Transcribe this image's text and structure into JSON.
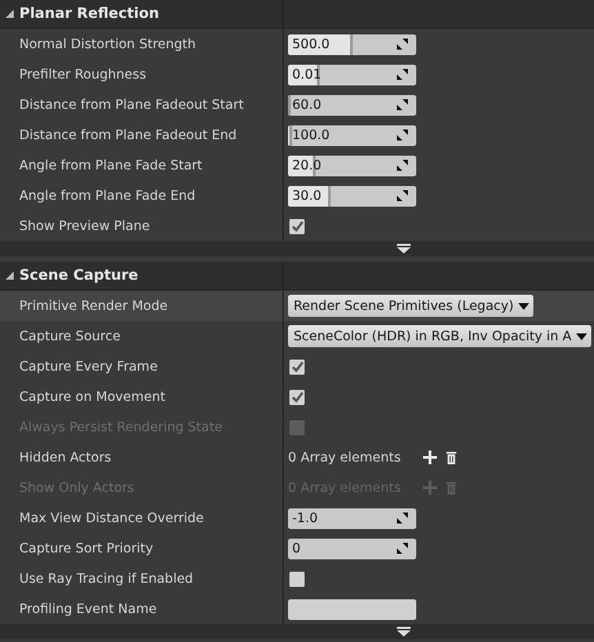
{
  "sections": [
    {
      "title": "Planar Reflection",
      "expanded": true,
      "rows": [
        {
          "label": "Normal Distortion Strength",
          "kind": "spin",
          "value": "500.0",
          "level": 0.5,
          "highlighted": false,
          "disabled": false
        },
        {
          "label": "Prefilter Roughness",
          "kind": "spin",
          "value": "0.01",
          "level": 0.25,
          "highlighted": false,
          "disabled": false
        },
        {
          "label": "Distance from Plane Fadeout Start",
          "kind": "spin",
          "value": "60.0",
          "level": 0.02,
          "highlighted": false,
          "disabled": false
        },
        {
          "label": "Distance from Plane Fadeout End",
          "kind": "spin",
          "value": "100.0",
          "level": 0.03,
          "highlighted": false,
          "disabled": false
        },
        {
          "label": "Angle from Plane Fade Start",
          "kind": "spin",
          "value": "20.0",
          "level": 0.22,
          "highlighted": false,
          "disabled": false
        },
        {
          "label": "Angle from Plane Fade End",
          "kind": "spin",
          "value": "30.0",
          "level": 0.33,
          "highlighted": false,
          "disabled": false
        },
        {
          "label": "Show Preview Plane",
          "kind": "checkbox",
          "checked": true,
          "highlighted": false,
          "disabled": false
        }
      ],
      "advanced": true
    },
    {
      "title": "Scene Capture",
      "expanded": true,
      "rows": [
        {
          "label": "Primitive Render Mode",
          "kind": "dropdown",
          "value": "Render Scene Primitives (Legacy)",
          "highlighted": true,
          "disabled": false
        },
        {
          "label": "Capture Source",
          "kind": "dropdown",
          "value": "SceneColor (HDR) in RGB, Inv Opacity in A",
          "highlighted": false,
          "disabled": false
        },
        {
          "label": "Capture Every Frame",
          "kind": "checkbox",
          "checked": true,
          "highlighted": false,
          "disabled": false
        },
        {
          "label": "Capture on Movement",
          "kind": "checkbox",
          "checked": true,
          "highlighted": false,
          "disabled": false
        },
        {
          "label": "Always Persist Rendering State",
          "kind": "checkbox",
          "checked": false,
          "highlighted": false,
          "disabled": true
        },
        {
          "label": "Hidden Actors",
          "kind": "array",
          "value": "0 Array elements",
          "highlighted": false,
          "disabled": false
        },
        {
          "label": "Show Only Actors",
          "kind": "array",
          "value": "0 Array elements",
          "highlighted": false,
          "disabled": true
        },
        {
          "label": "Max View Distance Override",
          "kind": "number",
          "value": "-1.0",
          "highlighted": false,
          "disabled": false
        },
        {
          "label": "Capture Sort Priority",
          "kind": "number",
          "value": "0",
          "highlighted": false,
          "disabled": false
        },
        {
          "label": "Use Ray Tracing if Enabled",
          "kind": "checkbox",
          "checked": false,
          "highlighted": false,
          "disabled": false
        },
        {
          "label": "Profiling Event Name",
          "kind": "text",
          "value": "",
          "highlighted": false,
          "disabled": false
        }
      ],
      "advanced": true
    }
  ]
}
